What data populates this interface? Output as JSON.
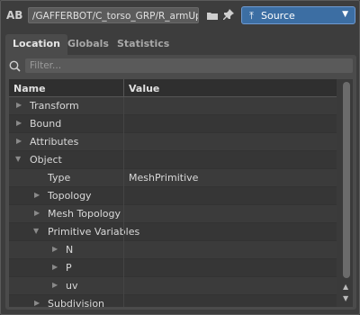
{
  "toolbar": {
    "ab_label": "AB",
    "path": "/GAFFERBOT/C_torso_GRP/R_armUp...",
    "folder_icon": "folder-icon",
    "pin_icon": "pin-icon",
    "source_label": "Source",
    "source_icon": "⤒",
    "source_arrow": "▼",
    "accent_color": "#3c6ea3"
  },
  "tabs": [
    {
      "label": "Location",
      "active": true
    },
    {
      "label": "Globals",
      "active": false
    },
    {
      "label": "Statistics",
      "active": false
    }
  ],
  "filter": {
    "placeholder": "Filter..."
  },
  "table": {
    "headers": [
      "Name",
      "Value"
    ],
    "rows": [
      {
        "name": "Transform",
        "value": "",
        "expanded": false
      },
      {
        "name": "Bound",
        "value": "",
        "expanded": false
      },
      {
        "name": "Attributes",
        "value": "",
        "expanded": false
      },
      {
        "name": "Object",
        "value": "",
        "expanded": true
      },
      {
        "name": "Type",
        "value": "MeshPrimitive",
        "expanded": null
      },
      {
        "name": "Topology",
        "value": "",
        "expanded": false
      },
      {
        "name": "Mesh Topology",
        "value": "",
        "expanded": false
      },
      {
        "name": "Primitive Variables",
        "value": "",
        "expanded": true
      },
      {
        "name": "N",
        "value": "",
        "expanded": false
      },
      {
        "name": "P",
        "value": "",
        "expanded": false
      },
      {
        "name": "uv",
        "value": "",
        "expanded": false
      },
      {
        "name": "Subdivision",
        "value": "",
        "expanded": false
      }
    ]
  }
}
